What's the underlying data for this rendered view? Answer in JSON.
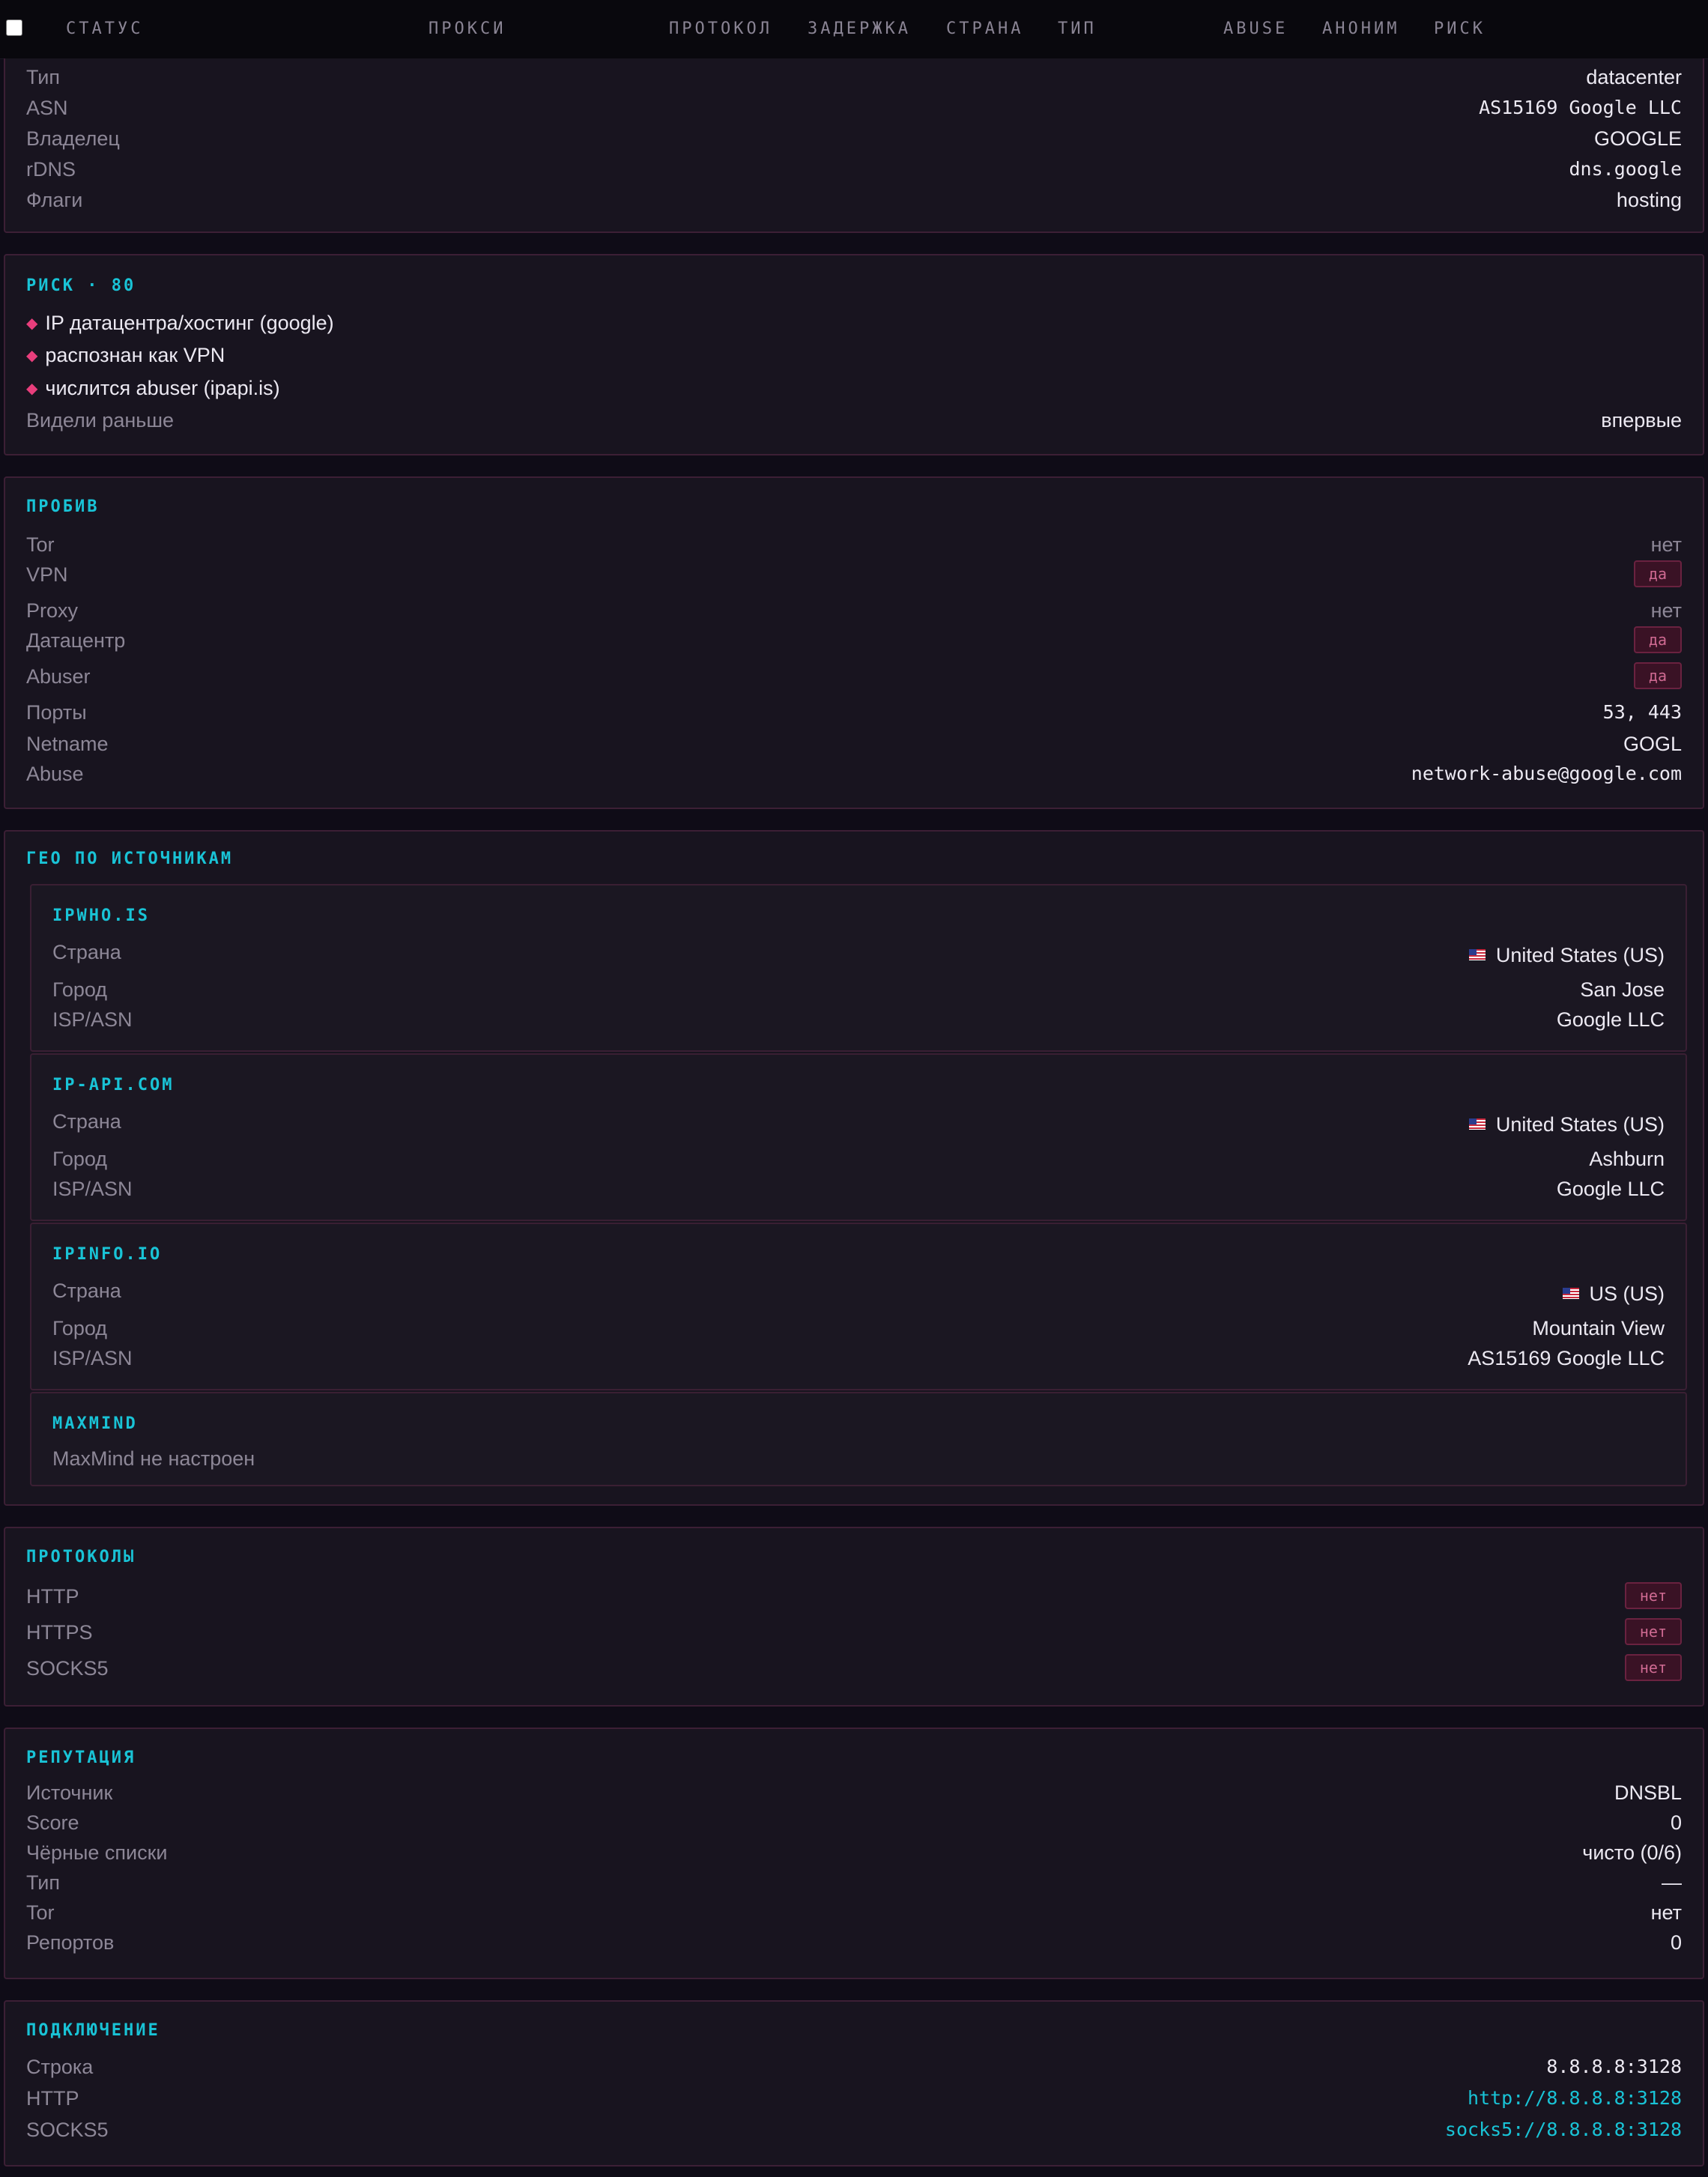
{
  "header": {
    "columns": [
      "СТАТУС",
      "ПРОКСИ",
      "ПРОТОКОЛ",
      "ЗАДЕРЖКА",
      "СТРАНА",
      "ТИП",
      "ABUSE",
      "АНОНИМ",
      "РИСК"
    ]
  },
  "network": {
    "rows": [
      {
        "label": "Тип",
        "value": "datacenter"
      },
      {
        "label": "ASN",
        "value": "AS15169 Google LLC"
      },
      {
        "label": "Владелец",
        "value": "GOOGLE"
      },
      {
        "label": "rDNS",
        "value": "dns.google"
      },
      {
        "label": "Флаги",
        "value": "hosting"
      }
    ]
  },
  "risk": {
    "title": "РИСК · 80",
    "reasons": [
      "IP датацентра/хостинг (google)",
      "распознан как VPN",
      "числится abuser (ipapi.is)"
    ],
    "seen_label": "Видели раньше",
    "seen_value": "впервые"
  },
  "probe": {
    "title": "ПРОБИВ",
    "rows": [
      {
        "label": "Tor",
        "value": "нет"
      },
      {
        "label": "VPN",
        "value": "да"
      },
      {
        "label": "Proxy",
        "value": "нет"
      },
      {
        "label": "Датацентр",
        "value": "да"
      },
      {
        "label": "Abuser",
        "value": "да"
      },
      {
        "label": "Порты",
        "value": "53, 443"
      },
      {
        "label": "Netname",
        "value": "GOGL"
      },
      {
        "label": "Abuse",
        "value": "network-abuse@google.com"
      }
    ]
  },
  "geo": {
    "title": "ГЕО ПО ИСТОЧНИКАМ",
    "sources": [
      {
        "name": "IPWHO.IS",
        "country_label": "Страна",
        "country": "United States (US)",
        "city_label": "Город",
        "city": "San Jose",
        "isp_label": "ISP/ASN",
        "isp": "Google LLC"
      },
      {
        "name": "IP-API.COM",
        "country_label": "Страна",
        "country": "United States (US)",
        "city_label": "Город",
        "city": "Ashburn",
        "isp_label": "ISP/ASN",
        "isp": "Google LLC"
      },
      {
        "name": "IPINFO.IO",
        "country_label": "Страна",
        "country": "US (US)",
        "city_label": "Город",
        "city": "Mountain View",
        "isp_label": "ISP/ASN",
        "isp": "AS15169 Google LLC"
      }
    ],
    "maxmind": {
      "name": "MAXMIND",
      "note": "MaxMind не настроен"
    }
  },
  "protocols": {
    "title": "ПРОТОКОЛЫ",
    "rows": [
      {
        "label": "HTTP",
        "value": "нет"
      },
      {
        "label": "HTTPS",
        "value": "нет"
      },
      {
        "label": "SOCKS5",
        "value": "нет"
      }
    ]
  },
  "reputation": {
    "title": "РЕПУТАЦИЯ",
    "rows": [
      {
        "label": "Источник",
        "value": "DNSBL"
      },
      {
        "label": "Score",
        "value": "0"
      },
      {
        "label": "Чёрные списки",
        "value": "чисто (0/6)"
      },
      {
        "label": "Тип",
        "value": "—"
      },
      {
        "label": "Tor",
        "value": "нет"
      },
      {
        "label": "Репортов",
        "value": "0"
      }
    ]
  },
  "connection": {
    "title": "ПОДКЛЮЧЕНИЕ",
    "rows": [
      {
        "label": "Строка",
        "value": "8.8.8.8:3128"
      },
      {
        "label": "HTTP",
        "value": "http://8.8.8.8:3128"
      },
      {
        "label": "SOCKS5",
        "value": "socks5://8.8.8.8:3128"
      }
    ]
  },
  "colors": {
    "accent": "#19c3d6",
    "danger": "#e83e7c",
    "background": "#0f0c17",
    "panel": "#18141f"
  }
}
